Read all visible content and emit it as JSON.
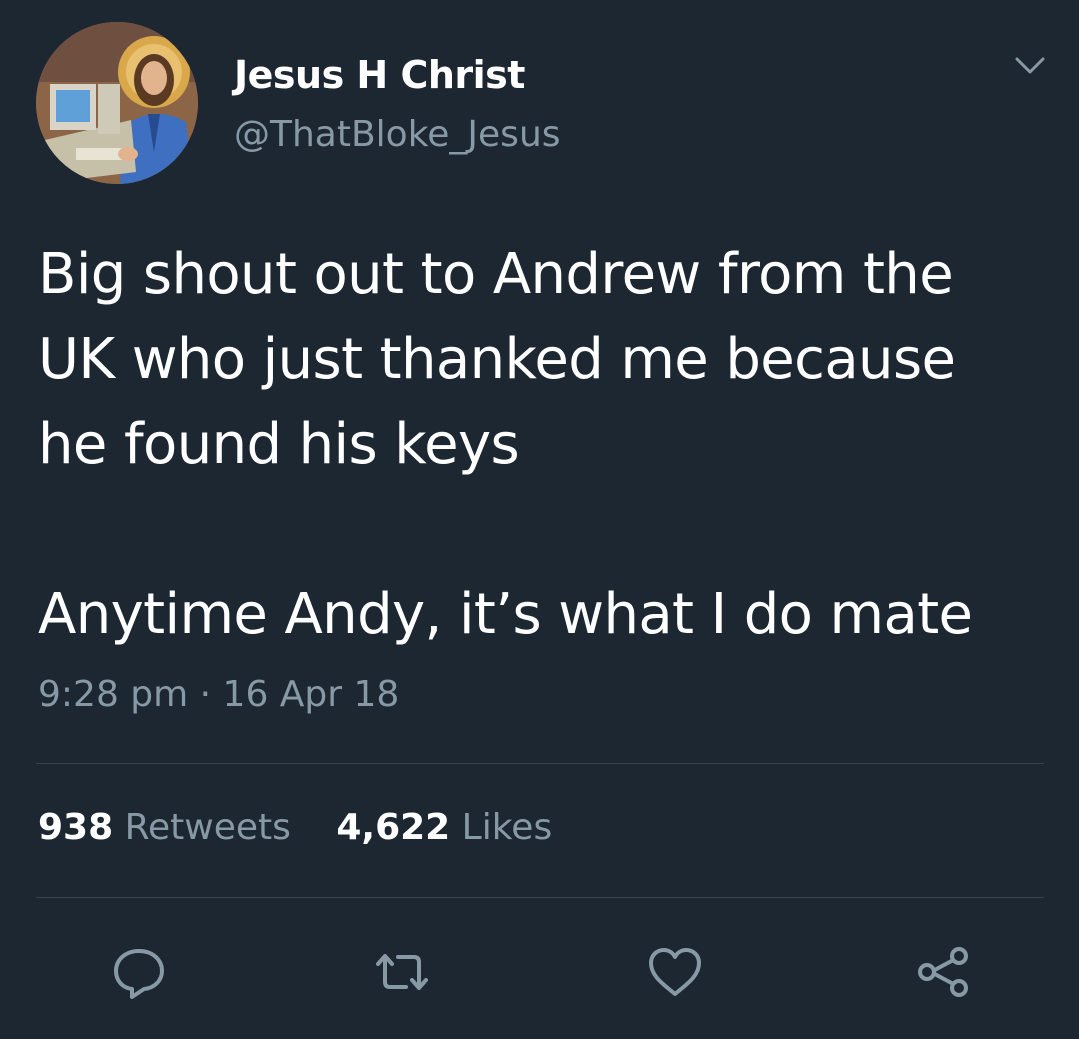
{
  "user": {
    "display_name": "Jesus H Christ",
    "handle": "@ThatBloke_Jesus"
  },
  "tweet": {
    "lines": [
      "Big shout out to Andrew from the",
      "UK who just thanked me because",
      "he found his keys",
      "",
      "Anytime Andy, it’s what I do mate"
    ],
    "timestamp": "9:28 pm · 16 Apr 18"
  },
  "stats": {
    "retweets_count": "938",
    "retweets_label": "Retweets",
    "likes_count": "4,622",
    "likes_label": "Likes"
  },
  "actions": [
    {
      "icon": "reply-icon"
    },
    {
      "icon": "retweet-icon"
    },
    {
      "icon": "like-heart-icon"
    },
    {
      "icon": "share-icon"
    }
  ],
  "colors": {
    "background": "#1c2732",
    "primary_text": "#ffffff",
    "secondary_text": "#8899a6",
    "divider": "#38444d"
  }
}
